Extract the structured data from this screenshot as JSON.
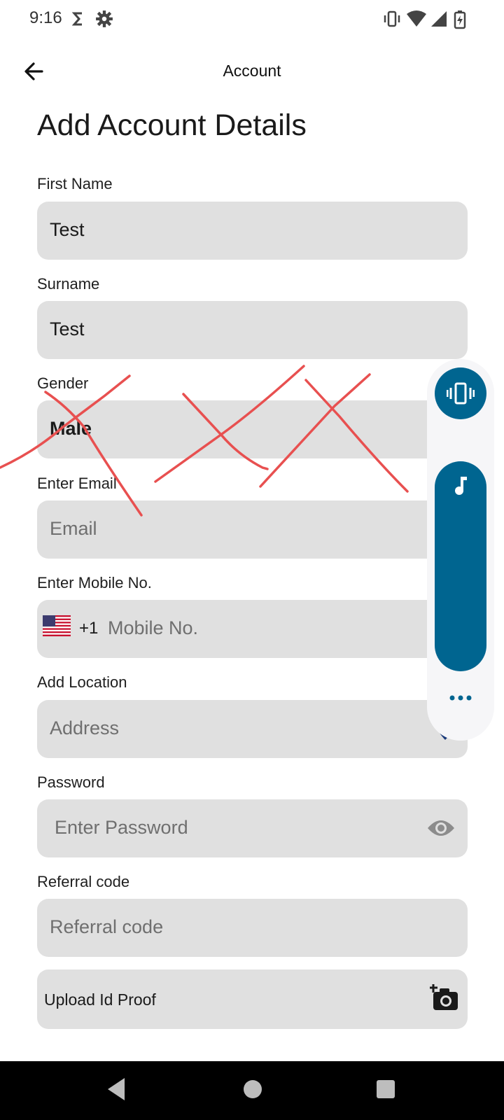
{
  "status_bar": {
    "time": "9:16"
  },
  "app_bar": {
    "title": "Account"
  },
  "page_title": "Add Account Details",
  "form": {
    "first_name": {
      "label": "First Name",
      "value": "Test"
    },
    "surname": {
      "label": "Surname",
      "value": "Test"
    },
    "gender": {
      "label": "Gender",
      "value": "Male"
    },
    "email": {
      "label": "Enter Email",
      "placeholder": "Email"
    },
    "mobile": {
      "label": "Enter Mobile No.",
      "dial_code": "+1",
      "placeholder": "Mobile No."
    },
    "location": {
      "label": "Add Location",
      "placeholder": "Address"
    },
    "password": {
      "label": "Password",
      "placeholder": "Enter Password"
    },
    "referral": {
      "label": "Referral code",
      "placeholder": "Referral code"
    },
    "upload": {
      "label": "Upload Id Proof"
    }
  },
  "icons": {
    "back": "arrow-left-icon",
    "location": "map-pin-icon",
    "password_toggle": "eye-icon",
    "upload": "add-camera-icon",
    "volume_mode": "vibrate-icon",
    "volume_stream": "music-note-icon",
    "volume_more": "more-horiz-icon"
  },
  "colors": {
    "field_bg": "#e0e0e0",
    "volume_accent": "#006590",
    "pin": "#1a3a7a",
    "scribble": "#e85050"
  }
}
